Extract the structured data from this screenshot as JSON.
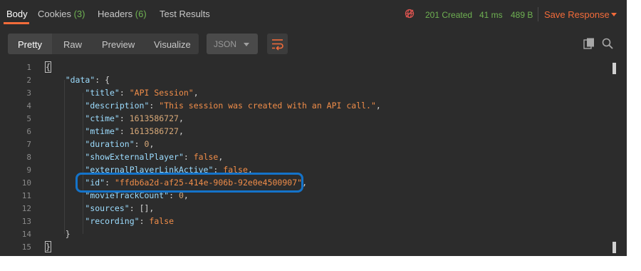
{
  "tabs": [
    {
      "label": "Body",
      "count": ""
    },
    {
      "label": "Cookies",
      "count": "(3)"
    },
    {
      "label": "Headers",
      "count": "(6)"
    },
    {
      "label": "Test Results",
      "count": ""
    }
  ],
  "status": {
    "code": "201 Created",
    "time": "41 ms",
    "size": "489 B",
    "save_label": "Save Response"
  },
  "toolbar": {
    "views": [
      "Pretty",
      "Raw",
      "Preview",
      "Visualize"
    ],
    "active_view": "Pretty",
    "format": "JSON",
    "icons": [
      "wrap-lines-icon",
      "copy-icon",
      "search-icon"
    ]
  },
  "code_lines": [
    {
      "n": "1"
    },
    {
      "n": "2"
    },
    {
      "n": "3"
    },
    {
      "n": "4"
    },
    {
      "n": "5"
    },
    {
      "n": "6"
    },
    {
      "n": "7"
    },
    {
      "n": "8"
    },
    {
      "n": "9"
    },
    {
      "n": "10"
    },
    {
      "n": "11"
    },
    {
      "n": "12"
    },
    {
      "n": "13"
    },
    {
      "n": "14"
    },
    {
      "n": "15"
    }
  ],
  "json": {
    "root_key": "\"data\"",
    "fields": [
      {
        "key": "\"title\"",
        "value": "\"API Session\"",
        "type": "string"
      },
      {
        "key": "\"description\"",
        "value": "\"This session was created with an API call.\"",
        "type": "string"
      },
      {
        "key": "\"ctime\"",
        "value": "1613586727",
        "type": "number"
      },
      {
        "key": "\"mtime\"",
        "value": "1613586727",
        "type": "number"
      },
      {
        "key": "\"duration\"",
        "value": "0",
        "type": "number"
      },
      {
        "key": "\"showExternalPlayer\"",
        "value": "false",
        "type": "bool"
      },
      {
        "key": "\"externalPlayerLinkActive\"",
        "value": "false",
        "type": "bool"
      },
      {
        "key": "\"id\"",
        "value": "\"ffdb6a2d-af25-414e-906b-92e0e4500907\"",
        "type": "string"
      },
      {
        "key": "\"movieTrackCount\"",
        "value": "0",
        "type": "number"
      },
      {
        "key": "\"sources\"",
        "value": "[]",
        "type": "punct"
      },
      {
        "key": "\"recording\"",
        "value": "false",
        "type": "bool"
      }
    ]
  },
  "colors": {
    "accent": "#f26b3a",
    "status_ok": "#6fb152",
    "highlight": "#1473c9",
    "json_key": "#9cdcfe",
    "json_string": "#f08d49"
  }
}
